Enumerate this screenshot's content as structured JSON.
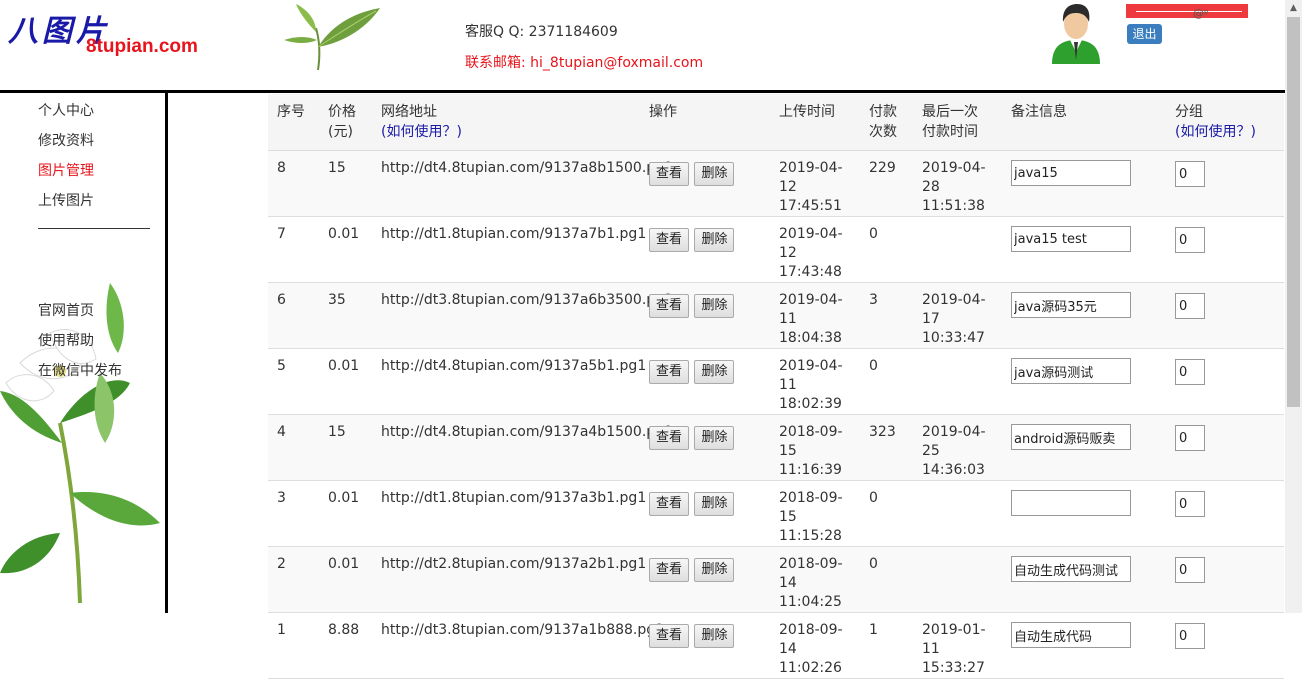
{
  "header": {
    "logo_cn": "八图片",
    "logo_en": "8tupian.com",
    "service_qq": "客服Q Q: 2371184609",
    "service_mail": "联系邮箱: hi_8tupian@foxmail.com",
    "user_mark": "@ᵖ",
    "logout_label": "退出"
  },
  "sidebar": {
    "items": [
      {
        "label": "个人中心"
      },
      {
        "label": "修改资料"
      },
      {
        "label": "图片管理"
      },
      {
        "label": "上传图片"
      },
      {
        "label": "官网首页"
      },
      {
        "label": "使用帮助"
      },
      {
        "label": "在微信中发布"
      }
    ],
    "active_index": 2
  },
  "table": {
    "headers": {
      "seq": "序号",
      "price": "价格",
      "price_unit": "(元)",
      "url": "网络地址",
      "url_help": "(如何使用？)",
      "ops": "操作",
      "upload_time": "上传时间",
      "pay_count_1": "付款",
      "pay_count_2": "次数",
      "last_pay_1": "最后一次",
      "last_pay_2": "付款时间",
      "note": "备注信息",
      "group": "分组",
      "group_help": "(如何使用？)"
    },
    "view_label": "查看",
    "delete_label": "删除",
    "rows": [
      {
        "seq": "8",
        "price": "15",
        "url": "http://dt4.8tupian.com/9137a8b1500.pg1",
        "upload_date": "2019-04-12",
        "upload_time": "17:45:51",
        "pay_count": "229",
        "last_pay_date": "2019-04-28",
        "last_pay_time": "11:51:38",
        "note": "java15",
        "group": "0"
      },
      {
        "seq": "7",
        "price": "0.01",
        "url": "http://dt1.8tupian.com/9137a7b1.pg1",
        "upload_date": "2019-04-12",
        "upload_time": "17:43:48",
        "pay_count": "0",
        "last_pay_date": "",
        "last_pay_time": "",
        "note": "java15 test",
        "group": "0"
      },
      {
        "seq": "6",
        "price": "35",
        "url": "http://dt3.8tupian.com/9137a6b3500.pg1",
        "upload_date": "2019-04-11",
        "upload_time": "18:04:38",
        "pay_count": "3",
        "last_pay_date": "2019-04-17",
        "last_pay_time": "10:33:47",
        "note": "java源码35元",
        "group": "0"
      },
      {
        "seq": "5",
        "price": "0.01",
        "url": "http://dt4.8tupian.com/9137a5b1.pg1",
        "upload_date": "2019-04-11",
        "upload_time": "18:02:39",
        "pay_count": "0",
        "last_pay_date": "",
        "last_pay_time": "",
        "note": "java源码测试",
        "group": "0"
      },
      {
        "seq": "4",
        "price": "15",
        "url": "http://dt4.8tupian.com/9137a4b1500.pg1",
        "upload_date": "2018-09-15",
        "upload_time": "11:16:39",
        "pay_count": "323",
        "last_pay_date": "2019-04-25",
        "last_pay_time": "14:36:03",
        "note": "android源码贩卖",
        "group": "0"
      },
      {
        "seq": "3",
        "price": "0.01",
        "url": "http://dt1.8tupian.com/9137a3b1.pg1",
        "upload_date": "2018-09-15",
        "upload_time": "11:15:28",
        "pay_count": "0",
        "last_pay_date": "",
        "last_pay_time": "",
        "note": "",
        "group": "0"
      },
      {
        "seq": "2",
        "price": "0.01",
        "url": "http://dt2.8tupian.com/9137a2b1.pg1",
        "upload_date": "2018-09-14",
        "upload_time": "11:04:25",
        "pay_count": "0",
        "last_pay_date": "",
        "last_pay_time": "",
        "note": "自动生成代码测试",
        "group": "0"
      },
      {
        "seq": "1",
        "price": "8.88",
        "url": "http://dt3.8tupian.com/9137a1b888.pg1",
        "upload_date": "2018-09-14",
        "upload_time": "11:02:26",
        "pay_count": "1",
        "last_pay_date": "2019-01-11",
        "last_pay_time": "15:33:27",
        "note": "自动生成代码",
        "group": "0"
      }
    ]
  },
  "colors": {
    "brand_red": "#e8141b",
    "brand_blue": "#1a1aa8",
    "logout_blue": "#3a7ebf"
  },
  "icons": {
    "logo": "logo-icon",
    "leaf": "tea-leaf-icon",
    "avatar": "user-avatar-icon",
    "flower": "flower-decoration-icon"
  }
}
